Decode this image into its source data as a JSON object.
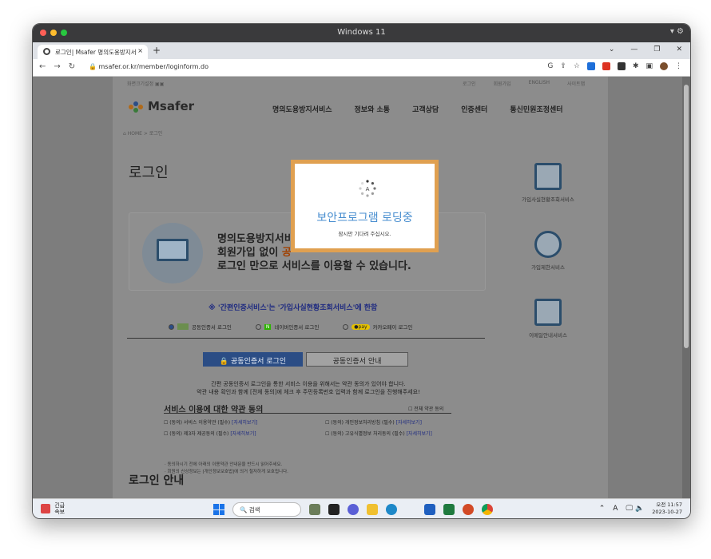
{
  "window": {
    "title": "Windows 11"
  },
  "browser": {
    "tab_title": "로그인| Msafer 명의도용방지서",
    "tab_close": "×",
    "new_tab": "+",
    "url": "msafer.or.kr/member/loginform.do"
  },
  "site": {
    "top_left": "화면크기설정",
    "top_links": [
      "로그인",
      "회원가입",
      "ENGLISH",
      "사이트맵"
    ],
    "logo_text": "Msafer",
    "nav": [
      "명의도용방지서비스",
      "정보와 소통",
      "고객상담",
      "인증센터",
      "통신민원조정센터"
    ],
    "breadcrumb": "HOME > 로그인",
    "page_title": "로그인",
    "box_lines": [
      "명의도용방지서비스는",
      "회원가입 없이",
      "로그인 만으로 서비스를 이용할 수 있습니다."
    ],
    "box_highlight": "공",
    "box_tail": "만",
    "notice": "※ '간편인증서비스'는 '가입사실현황조회서비스'에 한함",
    "radio_options": [
      "공동인증서 로그인",
      "네이버인증서 로그인",
      "카카오페이 로그인"
    ],
    "btn_login": "공동인증서 로그인",
    "btn_guide": "공동인증서 안내",
    "desc_line1": "간편 공동인증서 로그인을 통한 서비스 이용을 위해서는 약관 동의가 있어야 합니다.",
    "desc_line2": "약관 내용 확인과 함께 [전체 동의]에 체크 후 주민등록번호 입력과 함께 로그인을 진행해주세요!",
    "terms_title": "서비스 이용에 대한 약관 동의",
    "terms_all": "전체 약관 동의",
    "terms": [
      {
        "label": "(동의) 서비스 이용약관 (필수)",
        "link": "[자세히보기]"
      },
      {
        "label": "(동의) 개인정보처리방침 (필수)",
        "link": "[자세히보기]"
      },
      {
        "label": "(동의) 제3자 제공동의 (필수)",
        "link": "[자세히보기]"
      },
      {
        "label": "(동의) 고유식별정보 처리동의 (필수)",
        "link": "[자세히보기]"
      }
    ],
    "terms_note1": "· 동의하시기 전에 아래의 이용약관 안내문을 반드시 읽어주세요.",
    "terms_note2": "· 회원의 신상정보는 [개인정보보호법]에 의거 철저하게 보호됩니다.",
    "login_guide": "로그인 안내",
    "side_items": [
      "가입사실현황조회서비스",
      "가입제한서비스",
      "이메일안내서비스"
    ]
  },
  "modal": {
    "message": "보안프로그램 로딩중",
    "sub": "잠시만 기다려 주십시오."
  },
  "taskbar": {
    "news_line1": "긴급",
    "news_line2": "속보",
    "search_placeholder": "검색",
    "tray_lang": "A",
    "time": "오전 11:57",
    "date": "2023-10-27"
  }
}
